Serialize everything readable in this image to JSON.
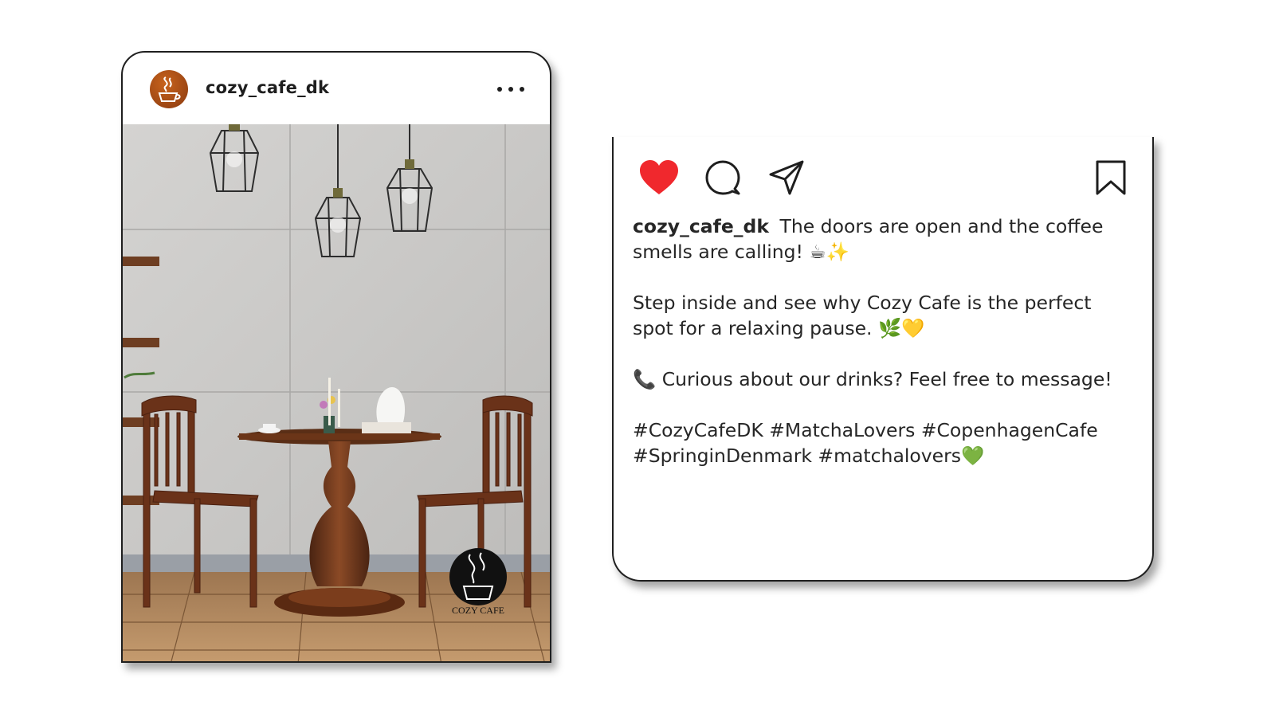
{
  "post": {
    "username": "cozy_cafe_dk",
    "more_label": "More options",
    "image_alt": "Cafe interior with round wooden table, two bentwood chairs and pendant lamps",
    "watermark": "COZY CAFE"
  },
  "caption": {
    "username": "cozy_cafe_dk",
    "line1": "The doors are open and the coffee smells are calling! ☕✨",
    "line2": "Step inside and see why Cozy Cafe is the perfect spot for a relaxing pause. 🌿💛",
    "line3": "📞 Curious about our drinks? Feel free to message!",
    "line4": "#CozyCafeDK #MatchaLovers #CopenhagenCafe #SpringinDenmark #matchalovers💚"
  },
  "actions": {
    "like_icon": "heart-icon",
    "comment_icon": "comment-icon",
    "share_icon": "paper-plane-icon",
    "save_icon": "bookmark-icon"
  },
  "colors": {
    "heart": "#f0282d",
    "avatar": "#a8461a",
    "text": "#262626"
  }
}
